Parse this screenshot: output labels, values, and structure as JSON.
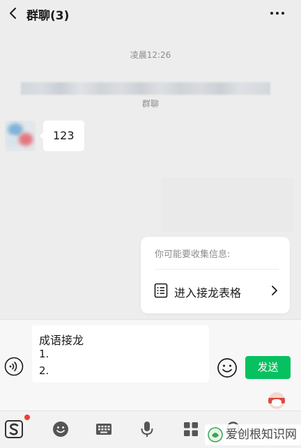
{
  "header": {
    "title": "群聊(3)",
    "back_icon": "chevron-left-icon",
    "more_icon": "more-dots-icon"
  },
  "chat": {
    "timestamp": "凌晨12:26",
    "group_label": "群聊",
    "messages": [
      {
        "sender": "other",
        "text": "123"
      }
    ]
  },
  "suggestion": {
    "title": "你可能要收集信息:",
    "action_label": "进入接龙表格",
    "action_icon": "form-list-icon"
  },
  "composer": {
    "lines": [
      "成语接龙",
      "1.",
      "2."
    ],
    "send_label": "发送",
    "voice_icon": "voice-icon",
    "emoji_icon": "emoji-icon"
  },
  "keyboard_toolbar": {
    "items": [
      "sogou-logo-icon",
      "emoji-icon",
      "keyboard-icon",
      "mic-icon",
      "apps-grid-icon",
      "search-icon",
      "hide-keyboard-icon"
    ]
  },
  "watermark": {
    "text": "爱创根知识网"
  },
  "colors": {
    "background": "#ededed",
    "send_button": "#07c160",
    "badge": "#f23c32"
  }
}
